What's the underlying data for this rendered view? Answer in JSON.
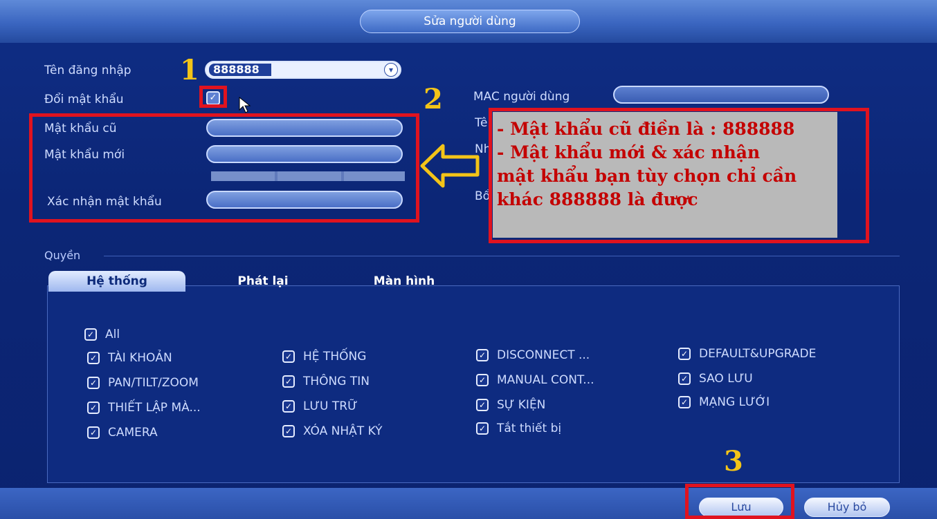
{
  "dialog": {
    "title": "Sửa người dùng"
  },
  "form": {
    "username_label": "Tên đăng nhập",
    "username_value": "888888",
    "change_password_label": "Đổi mật khẩu",
    "old_password_label": "Mật khẩu cũ",
    "new_password_label": "Mật khẩu mới",
    "confirm_password_label": "Xác nhận mật khẩu",
    "mac_label": "MAC người dùng",
    "partial_labels": [
      "Tê",
      "Nh",
      "Bổ"
    ]
  },
  "annotations": {
    "marker_1": "1",
    "marker_2": "2",
    "marker_3": "3",
    "note_lines": [
      "- Mật khẩu cũ điền là : 888888",
      "- Mật khẩu mới & xác nhận",
      "mật khẩu bạn tùy chọn chỉ cần",
      "khác 888888 là được"
    ],
    "colors": {
      "highlight": "#e0131f",
      "marker": "#f3c418",
      "note_text": "#c40000"
    }
  },
  "permissions": {
    "section_label": "Quyền",
    "tabs": [
      "Hệ thống",
      "Phát lại",
      "Màn hình"
    ],
    "items": [
      "All",
      "TÀI KHOẢN",
      "PAN/TILT/ZOOM",
      "THIẾT LẬP MÀ...",
      "CAMERA",
      "HỆ THỐNG",
      "THÔNG TIN",
      "LƯU TRỮ",
      "XÓA NHẬT KÝ",
      "DISCONNECT ...",
      "MANUAL CONT...",
      "SỰ KIỆN",
      "Tắt thiết bị",
      "DEFAULT&UPGRADE",
      "SAO LƯU",
      "MẠNG LƯỚI"
    ]
  },
  "buttons": {
    "save": "Lưu",
    "cancel": "Hủy bỏ"
  }
}
